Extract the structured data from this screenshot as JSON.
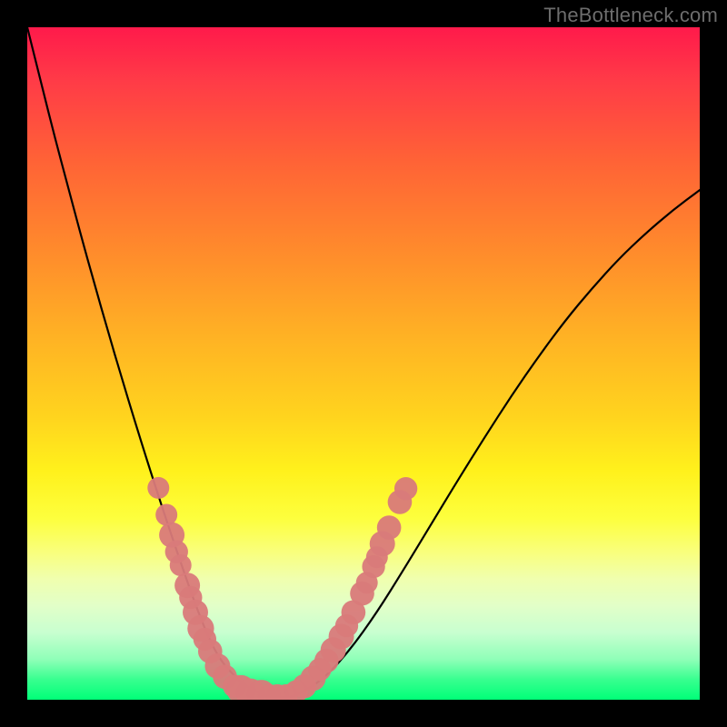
{
  "watermark": "TheBottleneck.com",
  "colors": {
    "curve_stroke": "#000000",
    "marker_fill": "#d97a7a",
    "marker_opacity": 0.95
  },
  "chart_data": {
    "type": "line",
    "title": "",
    "xlabel": "",
    "ylabel": "",
    "xlim": [
      0,
      100
    ],
    "ylim": [
      0,
      100
    ],
    "series": [
      {
        "name": "bottleneck-curve",
        "x": [
          0,
          2,
          4,
          6,
          8,
          10,
          12,
          14,
          16,
          18,
          20,
          22,
          24,
          25,
          26,
          27,
          28,
          29,
          30,
          32,
          34,
          36,
          38,
          40,
          44,
          48,
          52,
          56,
          60,
          64,
          68,
          72,
          76,
          80,
          84,
          88,
          92,
          96,
          100
        ],
        "y": [
          100,
          92,
          84,
          76.5,
          69,
          61.8,
          54.8,
          48,
          41.4,
          35,
          28.8,
          22.8,
          17,
          14.2,
          11.6,
          9.2,
          7.2,
          5.6,
          4.4,
          2.4,
          1.2,
          0.4,
          0.2,
          0.6,
          3,
          7.4,
          13,
          19.4,
          26,
          32.6,
          39,
          45.2,
          51,
          56.4,
          61.2,
          65.6,
          69.4,
          72.8,
          75.8
        ]
      }
    ],
    "markers": [
      {
        "x": 19.5,
        "y": 31.5,
        "r": 1.2
      },
      {
        "x": 20.7,
        "y": 27.5,
        "r": 1.2
      },
      {
        "x": 21.5,
        "y": 24.5,
        "r": 1.5
      },
      {
        "x": 22.2,
        "y": 22.0,
        "r": 1.3
      },
      {
        "x": 22.8,
        "y": 20.0,
        "r": 1.2
      },
      {
        "x": 23.8,
        "y": 17.0,
        "r": 1.5
      },
      {
        "x": 24.3,
        "y": 15.2,
        "r": 1.3
      },
      {
        "x": 25.0,
        "y": 13.0,
        "r": 1.5
      },
      {
        "x": 25.8,
        "y": 10.6,
        "r": 1.6
      },
      {
        "x": 26.4,
        "y": 9.0,
        "r": 1.3
      },
      {
        "x": 27.2,
        "y": 7.2,
        "r": 1.4
      },
      {
        "x": 28.3,
        "y": 5.0,
        "r": 1.5
      },
      {
        "x": 29.4,
        "y": 3.4,
        "r": 1.4
      },
      {
        "x": 30.8,
        "y": 2.0,
        "r": 1.3
      },
      {
        "x": 31.8,
        "y": 1.5,
        "r": 1.8
      },
      {
        "x": 33.2,
        "y": 1.0,
        "r": 1.8
      },
      {
        "x": 34.8,
        "y": 0.8,
        "r": 1.8
      },
      {
        "x": 36.0,
        "y": 0.6,
        "r": 1.3
      },
      {
        "x": 37.2,
        "y": 0.6,
        "r": 1.3
      },
      {
        "x": 38.5,
        "y": 0.6,
        "r": 1.3
      },
      {
        "x": 40.0,
        "y": 1.2,
        "r": 1.3
      },
      {
        "x": 41.2,
        "y": 2.0,
        "r": 1.4
      },
      {
        "x": 42.5,
        "y": 3.2,
        "r": 1.5
      },
      {
        "x": 43.5,
        "y": 4.5,
        "r": 1.3
      },
      {
        "x": 44.5,
        "y": 5.8,
        "r": 1.4
      },
      {
        "x": 45.5,
        "y": 7.4,
        "r": 1.5
      },
      {
        "x": 46.7,
        "y": 9.4,
        "r": 1.5
      },
      {
        "x": 47.5,
        "y": 11.0,
        "r": 1.3
      },
      {
        "x": 48.5,
        "y": 13.0,
        "r": 1.4
      },
      {
        "x": 49.8,
        "y": 15.8,
        "r": 1.4
      },
      {
        "x": 50.5,
        "y": 17.4,
        "r": 1.2
      },
      {
        "x": 51.5,
        "y": 19.8,
        "r": 1.3
      },
      {
        "x": 52.0,
        "y": 21.2,
        "r": 1.2
      },
      {
        "x": 52.8,
        "y": 23.2,
        "r": 1.5
      },
      {
        "x": 53.8,
        "y": 25.6,
        "r": 1.4
      },
      {
        "x": 55.4,
        "y": 29.4,
        "r": 1.4
      },
      {
        "x": 56.3,
        "y": 31.4,
        "r": 1.3
      }
    ]
  }
}
